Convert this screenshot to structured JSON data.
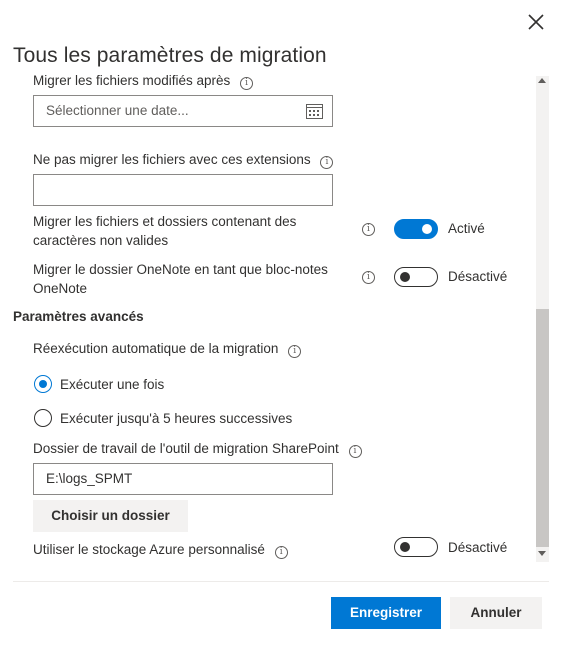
{
  "panel": {
    "title": "Tous les paramètres de migration",
    "close_icon": "close-icon"
  },
  "settings": {
    "modified_after_label": "Migrer les fichiers modifiés après",
    "date_placeholder": "Sélectionner une date...",
    "exclude_extensions_label": "Ne pas migrer les fichiers avec ces extensions",
    "exclude_extensions_value": "",
    "invalid_chars_label": "Migrer les fichiers et dossiers contenant des caractères non valides",
    "invalid_chars_state": "Activé",
    "onenote_label": "Migrer le dossier OneNote en tant que bloc-notes OneNote",
    "onenote_state": "Désactivé"
  },
  "advanced": {
    "section_title": "Paramètres avancés",
    "auto_rerun_label": "Réexécution automatique de la migration",
    "options": [
      {
        "label": "Exécuter une fois",
        "selected": true
      },
      {
        "label": "Exécuter jusqu'à 5 heures successives",
        "selected": false
      }
    ],
    "working_folder_label": "Dossier de travail de l'outil de migration SharePoint",
    "working_folder_value": "E:\\logs_SPMT",
    "choose_folder_button": "Choisir un dossier",
    "azure_storage_label": "Utiliser le stockage Azure personnalisé",
    "azure_storage_state": "Désactivé"
  },
  "footer": {
    "save_button": "Enregistrer",
    "cancel_button": "Annuler"
  },
  "colors": {
    "accent": "#0078d4",
    "text": "#323130",
    "secondary_button": "#f3f2f1"
  }
}
